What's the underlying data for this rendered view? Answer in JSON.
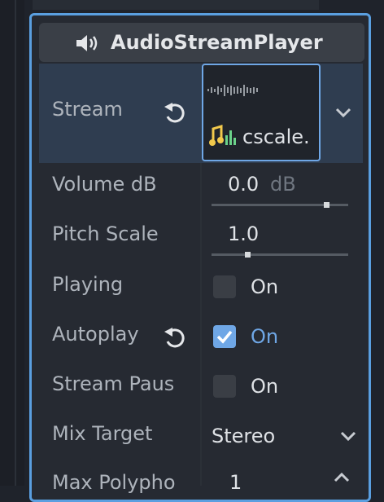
{
  "component": {
    "title": "AudioStreamPlayer",
    "icon": "speaker-icon"
  },
  "stream": {
    "label": "Stream",
    "file_name": "cscale.",
    "colors": {
      "accent": "#6fa7e6",
      "row_highlight": "#2f3d50"
    }
  },
  "properties": {
    "volume": {
      "label": "Volume dB",
      "value": "0.0",
      "unit": "dB",
      "slider_fraction": 0.84
    },
    "pitch": {
      "label": "Pitch Scale",
      "value": "1.0",
      "slider_fraction": 0.26
    },
    "playing": {
      "label": "Playing",
      "checked": false,
      "on_text": "On"
    },
    "autoplay": {
      "label": "Autoplay",
      "checked": true,
      "on_text": "On"
    },
    "stream_paused": {
      "label": "Stream Paus",
      "checked": false,
      "on_text": "On"
    },
    "mix_target": {
      "label": "Mix Target",
      "value": "Stereo"
    },
    "max_polyphony": {
      "label": "Max Polypho",
      "value": "1"
    }
  }
}
